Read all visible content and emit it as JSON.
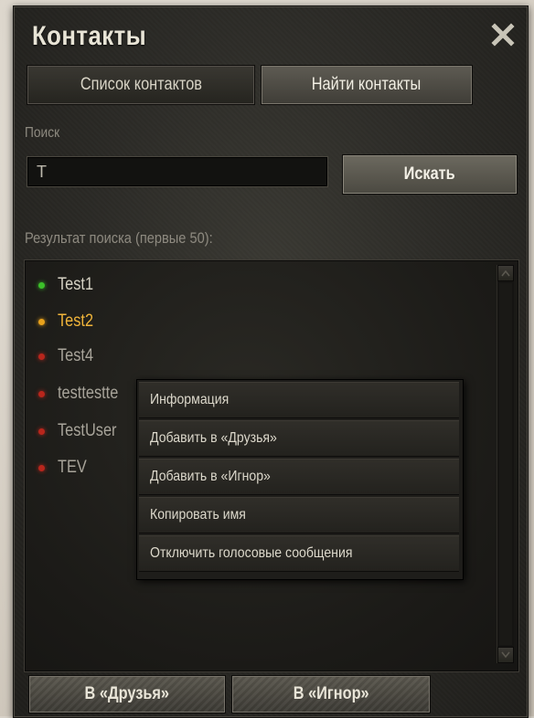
{
  "window": {
    "title": "Контакты"
  },
  "tabs": [
    {
      "label": "Список контактов",
      "active": false
    },
    {
      "label": "Найти контакты",
      "active": true
    }
  ],
  "search": {
    "label": "Поиск",
    "value": "T",
    "button_label": "Искать"
  },
  "results": {
    "label": "Результат поиска (первые 50):",
    "items": [
      {
        "name": "Test1",
        "status": "online",
        "status_color": "#3cbf2a",
        "text_color": "#d6d2c4"
      },
      {
        "name": "Test2",
        "status": "busy",
        "status_color": "#e9a21c",
        "text_color": "#f0b43a"
      },
      {
        "name": "Test4",
        "status": "offline",
        "status_color": "#b8261c",
        "text_color": "#a8a49a"
      },
      {
        "name": "testtestte",
        "status": "offline",
        "status_color": "#b8261c",
        "text_color": "#a8a49a"
      },
      {
        "name": "TestUser",
        "status": "offline",
        "status_color": "#b8261c",
        "text_color": "#a8a49a"
      },
      {
        "name": "TEV",
        "status": "offline",
        "status_color": "#b8261c",
        "text_color": "#a8a49a"
      }
    ]
  },
  "context_menu": {
    "items": [
      "Информация",
      "Добавить в «Друзья»",
      "Добавить в «Игнор»",
      "Копировать имя",
      "Отключить голосовые сообщения"
    ]
  },
  "bottom": {
    "add_friends_label": "В «Друзья»",
    "add_ignore_label": "В «Игнор»"
  },
  "icons": {
    "close": "close-icon",
    "scroll_up": "scroll-up-icon",
    "scroll_down": "scroll-down-icon"
  }
}
